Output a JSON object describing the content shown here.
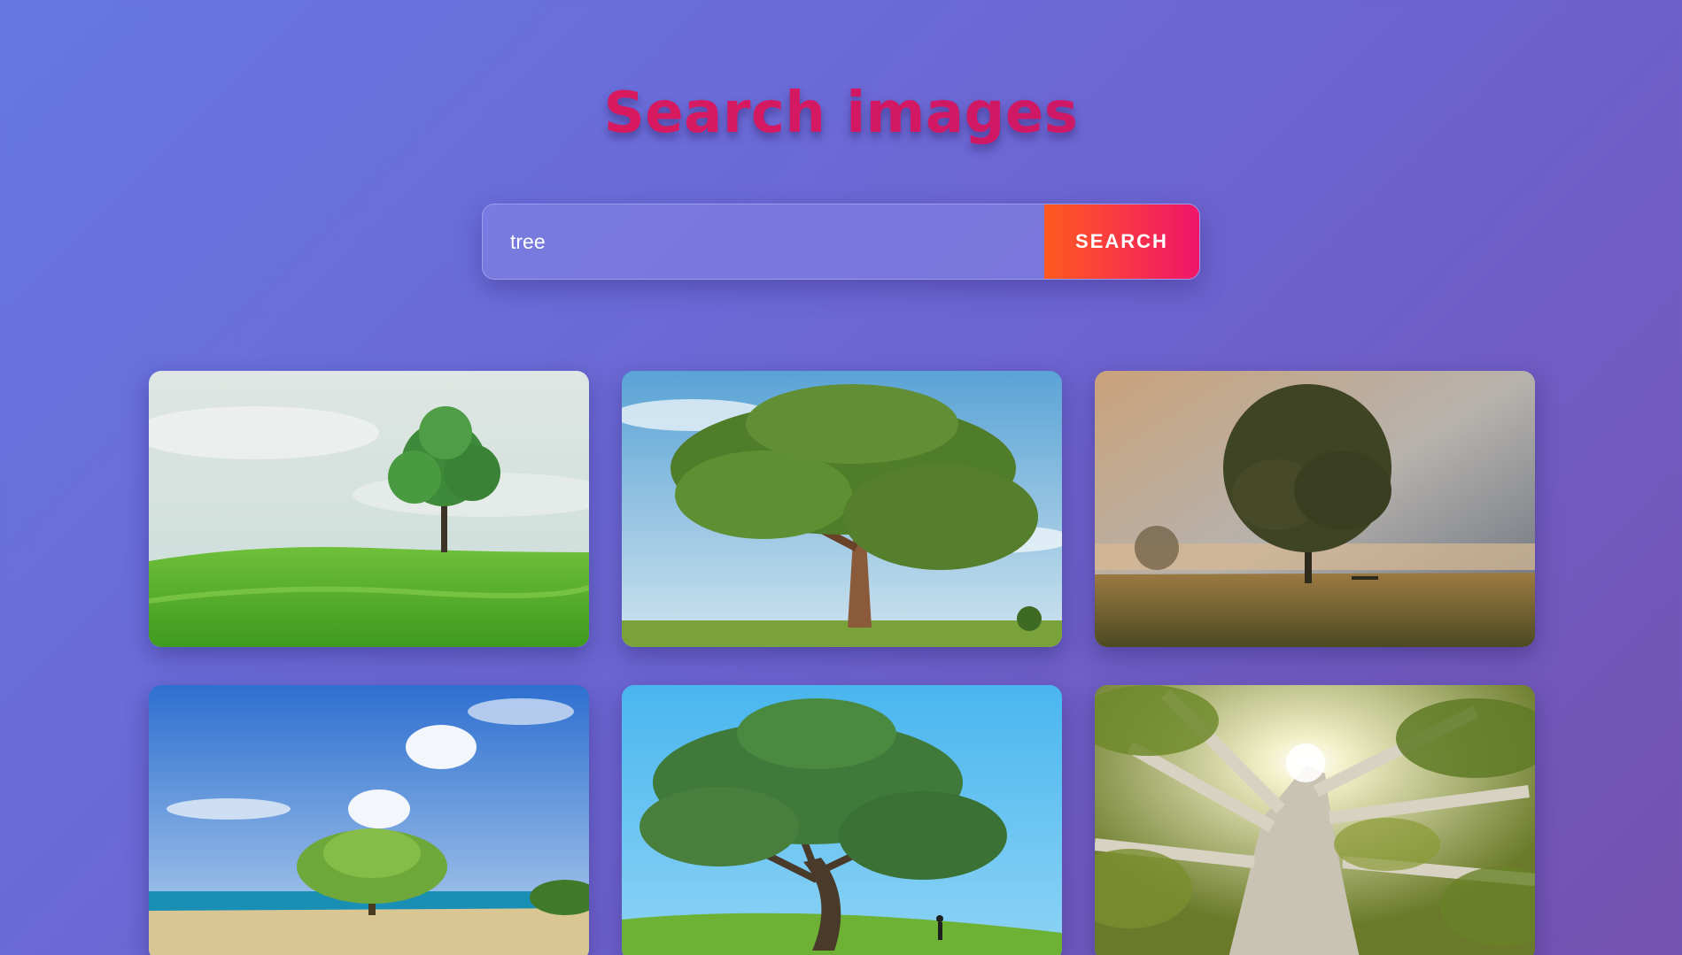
{
  "page": {
    "title": "Search images"
  },
  "search": {
    "value": "tree",
    "button_label": "SEARCH"
  },
  "results": [
    {
      "subject": "lone tree on green grass field"
    },
    {
      "subject": "large spreading tree under blue sky"
    },
    {
      "subject": "tree silhouette in misty sunrise meadow"
    },
    {
      "subject": "tree on tropical beach"
    },
    {
      "subject": "big tree on grassy hill with person"
    },
    {
      "subject": "sunlight through tree canopy"
    }
  ],
  "colors": {
    "title": "#d81b60",
    "button_start": "#ff5a1f",
    "button_end": "#f0146a"
  }
}
